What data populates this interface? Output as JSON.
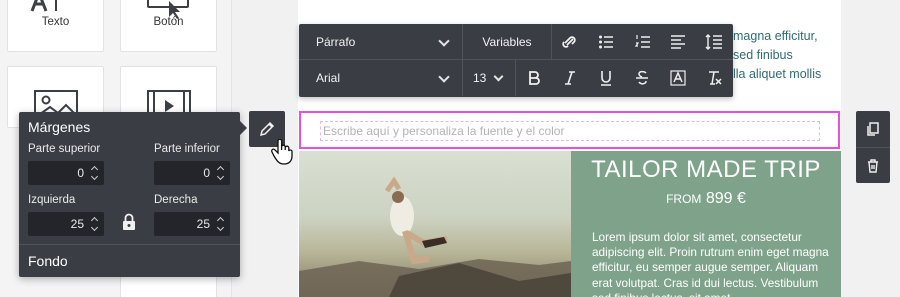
{
  "blocks": {
    "items": [
      {
        "label": "Texto",
        "icon": "text-block-icon"
      },
      {
        "label": "Botón",
        "icon": "button-block-icon"
      },
      {
        "label": "",
        "icon": "image-block-icon"
      },
      {
        "label": "",
        "icon": "video-block-icon"
      }
    ]
  },
  "canvas": {
    "top_text_lines": [
      "magna efficitur,",
      "sed finibus",
      "lla aliquet mollis"
    ],
    "text_placeholder": "Escribe aquí y personaliza la fuente y el color"
  },
  "toolbar": {
    "paragraph_style": "Párrafo",
    "variables_label": "Variables",
    "font_family": "Arial",
    "font_size": "13",
    "icons": [
      "unlink-icon",
      "bullet-list-icon",
      "numbered-list-icon",
      "align-left-icon",
      "line-height-icon",
      "bold-icon",
      "italic-icon",
      "underline-icon",
      "strikethrough-icon",
      "text-color-icon",
      "clear-format-icon"
    ]
  },
  "product": {
    "title": "TAILOR MADE TRIP",
    "from_label": "FROM",
    "price": "899 €",
    "body": "Lorem ipsum dolor sit amet, consectetur adipiscing elit. Proin rutrum enim eget magna efficitur, eu semper augue semper. Aliquam erat volutpat. Cras id dui lectus. Vestibulum sed finibus lectus, sit amet"
  },
  "margins_popover": {
    "title": "Márgenes",
    "top_label": "Parte superior",
    "top_value": "0",
    "bottom_label": "Parte inferior",
    "bottom_value": "0",
    "left_label": "Izquierda",
    "left_value": "25",
    "right_label": "Derecha",
    "right_value": "25",
    "footer_label": "Fondo"
  },
  "colors": {
    "highlight_border": "#e84ee0",
    "toolbar_bg": "#3a3d44",
    "product_bg": "#7ea38a",
    "link_text": "#2f6b73"
  }
}
